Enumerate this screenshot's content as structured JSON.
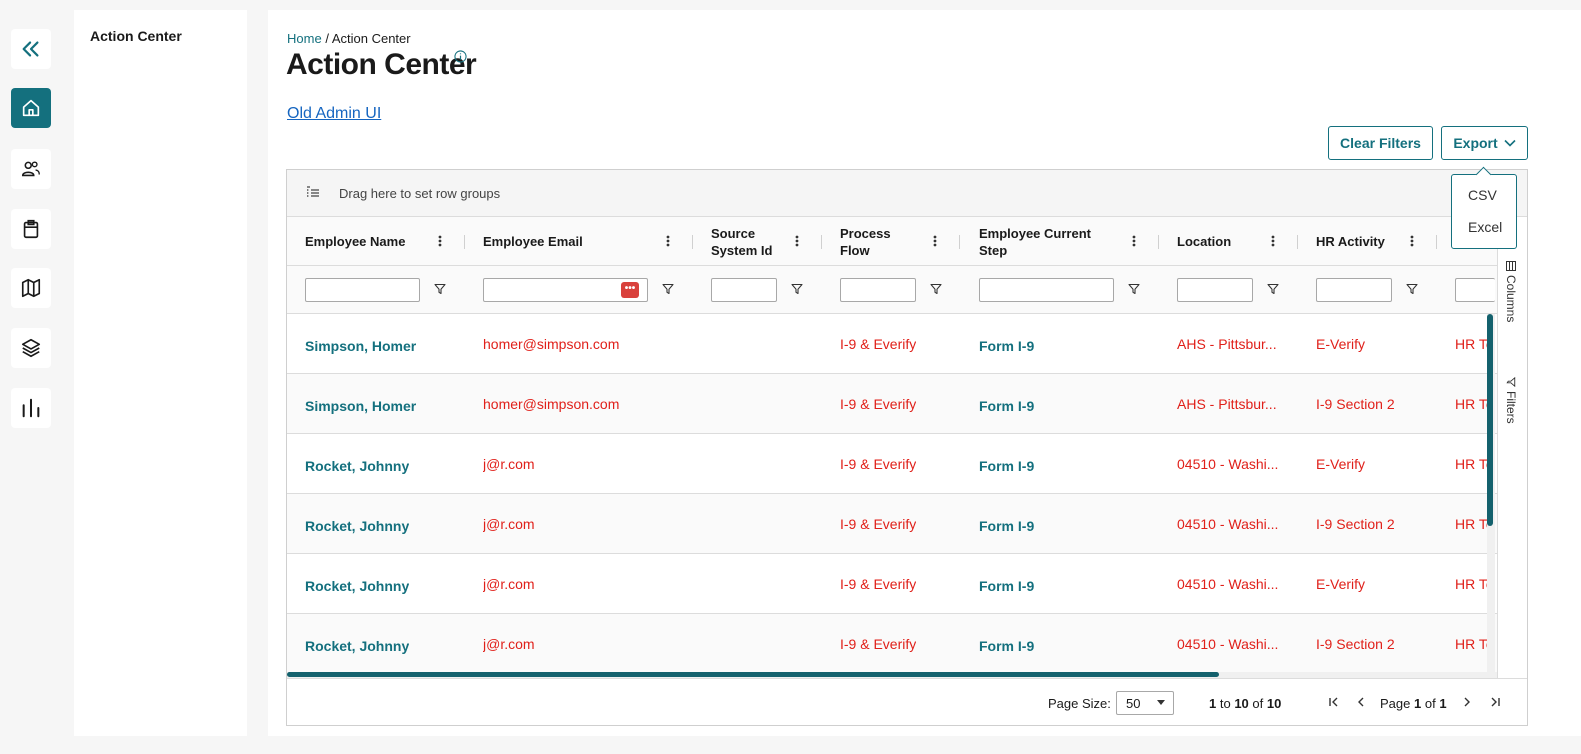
{
  "nav": {
    "collapse_icon": "double-chevron-left-icon",
    "items": [
      {
        "icon": "home-icon",
        "active": true
      },
      {
        "icon": "people-icon",
        "active": false
      },
      {
        "icon": "clipboard-icon",
        "active": false
      },
      {
        "icon": "map-icon",
        "active": false
      },
      {
        "icon": "layers-icon",
        "active": false
      },
      {
        "icon": "bar-chart-icon",
        "active": false
      }
    ]
  },
  "subnav": {
    "title": "Action Center"
  },
  "breadcrumb": {
    "home": "Home",
    "separator": "/",
    "current": "Action Center"
  },
  "page": {
    "title": "Action Center",
    "old_admin_link": "Old Admin UI"
  },
  "toolbar": {
    "clear_filters": "Clear Filters",
    "export": "Export"
  },
  "export_menu": {
    "items": [
      "CSV",
      "Excel"
    ]
  },
  "grid": {
    "group_bar_text": "Drag here to set row groups",
    "columns": [
      {
        "line1": "Employee Name",
        "line2": ""
      },
      {
        "line1": "Employee Email",
        "line2": ""
      },
      {
        "line1": "Source",
        "line2": "System Id"
      },
      {
        "line1": "Process",
        "line2": "Flow"
      },
      {
        "line1": "Employee Current",
        "line2": "Step"
      },
      {
        "line1": "Location",
        "line2": ""
      },
      {
        "line1": "HR Activity",
        "line2": ""
      }
    ],
    "rows": [
      {
        "name": "Simpson, Homer",
        "email": "homer@simpson.com",
        "source": "",
        "flow": "I-9 & Everify",
        "step": "Form I-9",
        "location": "AHS - Pittsbur...",
        "activity": "E-Verify",
        "extra": "HR Te"
      },
      {
        "name": "Simpson, Homer",
        "email": "homer@simpson.com",
        "source": "",
        "flow": "I-9 & Everify",
        "step": "Form I-9",
        "location": "AHS - Pittsbur...",
        "activity": "I-9 Section 2",
        "extra": "HR Te"
      },
      {
        "name": "Rocket, Johnny",
        "email": "j@r.com",
        "source": "",
        "flow": "I-9 & Everify",
        "step": "Form I-9",
        "location": "04510 - Washi...",
        "activity": "E-Verify",
        "extra": "HR Te"
      },
      {
        "name": "Rocket, Johnny",
        "email": "j@r.com",
        "source": "",
        "flow": "I-9 & Everify",
        "step": "Form I-9",
        "location": "04510 - Washi...",
        "activity": "I-9 Section 2",
        "extra": "HR Te"
      },
      {
        "name": "Rocket, Johnny",
        "email": "j@r.com",
        "source": "",
        "flow": "I-9 & Everify",
        "step": "Form I-9",
        "location": "04510 - Washi...",
        "activity": "E-Verify",
        "extra": "HR Te"
      },
      {
        "name": "Rocket, Johnny",
        "email": "j@r.com",
        "source": "",
        "flow": "I-9 & Everify",
        "step": "Form I-9",
        "location": "04510 - Washi...",
        "activity": "I-9 Section 2",
        "extra": "HR Te"
      }
    ],
    "side_tabs": {
      "columns": "Columns",
      "filters": "Filters"
    },
    "password_badge": "•••"
  },
  "pager": {
    "page_size_label": "Page Size:",
    "page_size": "50",
    "from": "1",
    "to_word": "to",
    "to": "10",
    "of_word": "of",
    "total": "10",
    "page_word": "Page",
    "page": "1",
    "page_of_word": "of",
    "pages": "1"
  },
  "colors": {
    "accent": "#14707e",
    "link": "#1565c0",
    "error_text": "#e0201a",
    "badge_red": "#d9413c"
  }
}
